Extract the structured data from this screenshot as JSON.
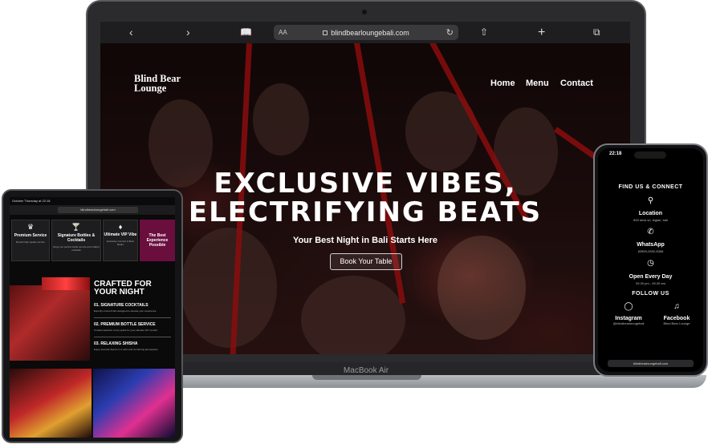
{
  "laptop": {
    "browser": {
      "url": "blindbearloungebali.com",
      "aa_label": "AA"
    },
    "site": {
      "brand": "Blind Bear Lounge",
      "nav": [
        "Home",
        "Menu",
        "Contact"
      ],
      "headline_line1": "EXCLUSIVE VIBES,",
      "headline_line2": "ELECTRIFYING BEATS",
      "subheadline": "Your Best Night in Bali Starts Here",
      "cta": "Book Your Table"
    },
    "device_label": "MacBook Air"
  },
  "tablet": {
    "status": "October Thursday at 22:18",
    "url": "blindbearloungebali.com",
    "cards": [
      {
        "title": "Premium Service",
        "desc": "Benefit high quality service",
        "icon": "crown-icon"
      },
      {
        "title": "Signature Bottles & Cocktails",
        "desc": "Enjoy our perfect bottle service and crafted cocktails",
        "icon": "glasses-icon"
      },
      {
        "title": "Ultimate VIP Vibe",
        "desc": "Exclusive Comfort & Best Beats",
        "icon": "diamond-icon"
      },
      {
        "title": "The Best Experience Possible",
        "desc": "",
        "icon": ""
      }
    ],
    "crafted_heading": "CRAFTED FOR YOUR NIGHT",
    "items": [
      {
        "title": "01. SIGNATURE COCKTAILS",
        "desc": "Expertly mixed drinks designed to elevate your experience"
      },
      {
        "title": "02. PREMIUM BOTTLE SERVICE",
        "desc": "Curated selection of top spirits for your ultimate VIP comfort"
      },
      {
        "title": "03. RELAXING SHISHA",
        "desc": "Enjoy aromatic flavors in a calm and comforting atmosphere"
      }
    ]
  },
  "phone": {
    "time": "22:18",
    "title": "FIND US & CONNECT",
    "location_label": "Location",
    "location_value": "653 dewi sri, legian, bali",
    "whatsapp_label": "WhatsApp",
    "whatsapp_value": "62859-2652-8368",
    "hours_label": "Open Every Day",
    "hours_value": "09.00 pm - 05.00 am",
    "follow_title": "FOLLOW US",
    "instagram_label": "Instagram",
    "instagram_value": "@blindbearloungebali",
    "facebook_label": "Facebook",
    "facebook_value": "Blind Bear Lounge",
    "url": "blindbearloungebali.com"
  }
}
